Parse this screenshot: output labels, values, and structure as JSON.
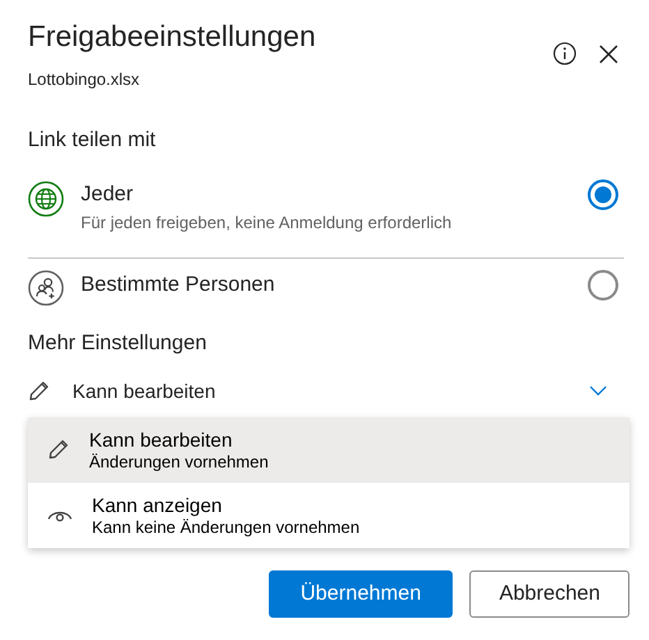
{
  "dialog": {
    "title": "Freigabeeinstellungen",
    "filename": "Lottobingo.xlsx"
  },
  "share_section": {
    "heading": "Link teilen mit",
    "options": [
      {
        "kind": "everyone",
        "label": "Jeder",
        "description": "Für jeden freigeben, keine Anmeldung erforderlich",
        "selected": true
      },
      {
        "kind": "specific",
        "label": "Bestimmte Personen",
        "selected": false
      }
    ]
  },
  "more_settings": {
    "heading": "Mehr Einstellungen",
    "permission": {
      "kind": "edit",
      "value": "Kann bearbeiten",
      "expanded": true
    },
    "menu": [
      {
        "kind": "edit",
        "label": "Kann bearbeiten",
        "description": "Änderungen vornehmen",
        "selected": true
      },
      {
        "kind": "view",
        "label": "Kann anzeigen",
        "description": "Kann keine Änderungen vornehmen",
        "selected": false
      }
    ]
  },
  "buttons": [
    {
      "kind": "primary",
      "label": "Übernehmen"
    },
    {
      "kind": "secondary",
      "label": "Abbrechen"
    }
  ]
}
